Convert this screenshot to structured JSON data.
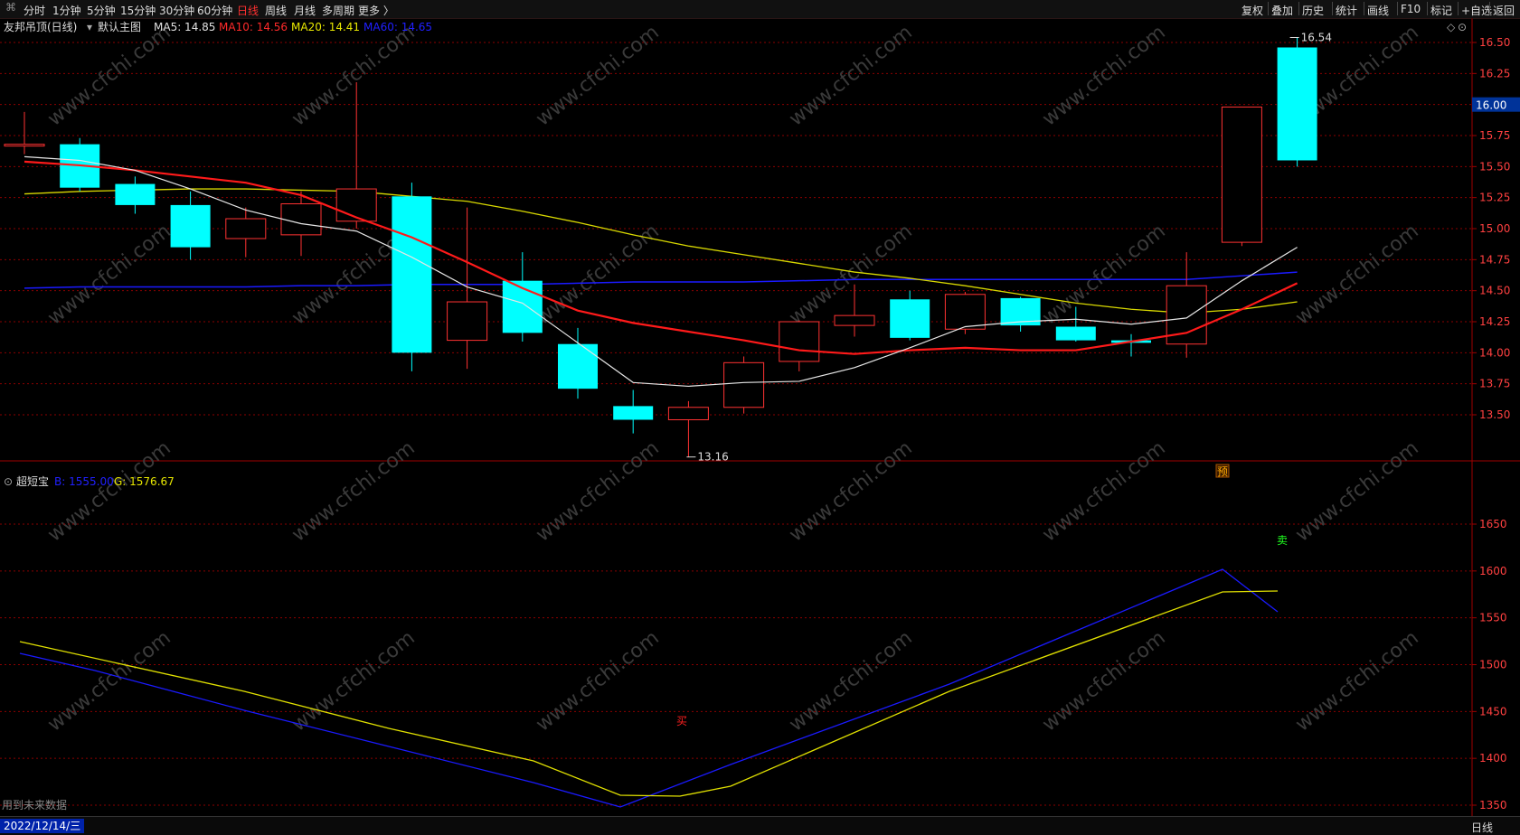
{
  "toolbar": {
    "periods": [
      "分时",
      "1分钟",
      "5分钟",
      "15分钟",
      "30分钟",
      "60分钟",
      "日线",
      "周线",
      "月线",
      "多周期",
      "更多 〉"
    ],
    "active_period": "日线",
    "right_buttons": [
      "复权",
      "叠加",
      "历史",
      "统计",
      "画线",
      "F10",
      "标记",
      "+自选",
      "返回"
    ]
  },
  "main_panel": {
    "title": "友邦吊顶(日线)",
    "chart_name": "默认主图",
    "ma_legend": [
      {
        "label": "MA5: 14.85",
        "color": "#e0e0e0"
      },
      {
        "label": "MA10: 14.56",
        "color": "#ff2a2a"
      },
      {
        "label": "MA20: 14.41",
        "color": "#e8e800"
      },
      {
        "label": "MA60: 14.65",
        "color": "#2020ff"
      }
    ],
    "current_price_tag": "16.00",
    "high_label": "16.54",
    "low_label": "13.16",
    "forecast_mark": "预",
    "y_ticks": [
      "16.50",
      "16.25",
      "16.00",
      "15.75",
      "15.50",
      "15.25",
      "15.00",
      "14.75",
      "14.50",
      "14.25",
      "14.00",
      "13.75",
      "13.50"
    ]
  },
  "sub_panel": {
    "name": "超短宝",
    "legend": [
      {
        "label": "B: 1555.00",
        "color": "#2020ff"
      },
      {
        "label": "G: 1576.67",
        "color": "#e8e800"
      }
    ],
    "buy_mark": "买",
    "sell_mark": "卖",
    "note": "用到未来数据",
    "y_ticks": [
      "1650",
      "1600",
      "1550",
      "1500",
      "1450",
      "1400",
      "1350"
    ]
  },
  "bottom": {
    "date": "2022/12/14/三",
    "period": "日线"
  },
  "colors": {
    "up": "#ff3232",
    "down": "#00ffff",
    "grid": "#8b0000",
    "bg": "#000000",
    "axis_text": "#ff4040"
  },
  "watermark": "www.cfchi.com",
  "chart_data": [
    {
      "type": "candlestick",
      "title": "友邦吊顶(日线)",
      "candles": [
        {
          "open": 15.68,
          "close": 15.68,
          "high": 15.94,
          "low": 15.6
        },
        {
          "open": 15.68,
          "close": 15.33,
          "high": 15.73,
          "low": 15.3
        },
        {
          "open": 15.36,
          "close": 15.19,
          "high": 15.42,
          "low": 15.12
        },
        {
          "open": 15.19,
          "close": 14.85,
          "high": 15.3,
          "low": 14.75
        },
        {
          "open": 14.92,
          "close": 15.08,
          "high": 15.17,
          "low": 14.77
        },
        {
          "open": 14.95,
          "close": 15.2,
          "high": 15.3,
          "low": 14.78
        },
        {
          "open": 15.06,
          "close": 15.32,
          "high": 16.18,
          "low": 15.0
        },
        {
          "open": 15.26,
          "close": 14.0,
          "high": 15.37,
          "low": 13.85
        },
        {
          "open": 14.1,
          "close": 14.41,
          "high": 15.17,
          "low": 13.87
        },
        {
          "open": 14.58,
          "close": 14.16,
          "high": 14.81,
          "low": 14.09
        },
        {
          "open": 14.07,
          "close": 13.71,
          "high": 14.2,
          "low": 13.63
        },
        {
          "open": 13.57,
          "close": 13.46,
          "high": 13.7,
          "low": 13.35
        },
        {
          "open": 13.46,
          "close": 13.56,
          "high": 13.61,
          "low": 13.16
        },
        {
          "open": 13.56,
          "close": 13.92,
          "high": 13.97,
          "low": 13.51
        },
        {
          "open": 13.93,
          "close": 14.25,
          "high": 14.26,
          "low": 13.85
        },
        {
          "open": 14.22,
          "close": 14.3,
          "high": 14.55,
          "low": 14.13
        },
        {
          "open": 14.43,
          "close": 14.12,
          "high": 14.5,
          "low": 14.1
        },
        {
          "open": 14.19,
          "close": 14.47,
          "high": 14.49,
          "low": 14.15
        },
        {
          "open": 14.44,
          "close": 14.22,
          "high": 14.45,
          "low": 14.17
        },
        {
          "open": 14.21,
          "close": 14.1,
          "high": 14.37,
          "low": 14.09
        },
        {
          "open": 14.1,
          "close": 14.08,
          "high": 14.15,
          "low": 13.97
        },
        {
          "open": 14.07,
          "close": 14.54,
          "high": 14.81,
          "low": 13.96
        },
        {
          "open": 14.89,
          "close": 15.98,
          "high": 15.98,
          "low": 14.86
        },
        {
          "open": 16.46,
          "close": 15.55,
          "high": 16.54,
          "low": 15.5
        }
      ],
      "ma5": [
        15.58,
        15.55,
        15.47,
        15.32,
        15.15,
        15.04,
        14.98,
        14.77,
        14.53,
        14.4,
        14.08,
        13.76,
        13.73,
        13.76,
        13.77,
        13.88,
        14.04,
        14.21,
        14.25,
        14.27,
        14.23,
        14.28,
        14.58,
        14.85
      ],
      "ma10": [
        15.54,
        15.54,
        15.54,
        15.51,
        15.47,
        15.42,
        15.37,
        15.27,
        15.09,
        14.93,
        14.73,
        14.52,
        14.34,
        14.24,
        14.17,
        14.1,
        14.02,
        13.99,
        14.02,
        14.04,
        14.02,
        14.02,
        14.09,
        14.16,
        14.35,
        14.56
      ],
      "ma20": [
        15.28,
        15.3,
        15.31,
        15.32,
        15.32,
        15.31,
        15.3,
        15.26,
        15.22,
        15.14,
        15.05,
        14.95,
        14.86,
        14.79,
        14.72,
        14.65,
        14.6,
        14.54,
        14.47,
        14.4,
        14.35,
        14.32,
        14.35,
        14.41
      ],
      "ma60": [
        14.52,
        14.53,
        14.53,
        14.53,
        14.53,
        14.54,
        14.54,
        14.55,
        14.55,
        14.55,
        14.56,
        14.57,
        14.57,
        14.57,
        14.58,
        14.59,
        14.59,
        14.59,
        14.59,
        14.59,
        14.59,
        14.59,
        14.62,
        14.65
      ],
      "ylim": [
        13.0,
        16.65
      ]
    },
    {
      "type": "line",
      "title": "超短宝",
      "series": [
        {
          "name": "B",
          "values": [
            1492,
            1477,
            1462,
            1446,
            1430,
            1414,
            1398,
            1382,
            1366,
            1350,
            1344,
            1390,
            1405,
            1430,
            1455,
            1480,
            1505,
            1530,
            1555,
            1580,
            1600,
            1555
          ]
        },
        {
          "name": "G",
          "values": [
            1505,
            1489,
            1473,
            1456,
            1440,
            1424,
            1408,
            1392,
            1376,
            1361,
            1358,
            1370,
            1392,
            1417,
            1442,
            1467,
            1492,
            1517,
            1542,
            1567,
            1576,
            1577
          ]
        }
      ],
      "ylim": [
        1345,
        1700
      ]
    }
  ]
}
